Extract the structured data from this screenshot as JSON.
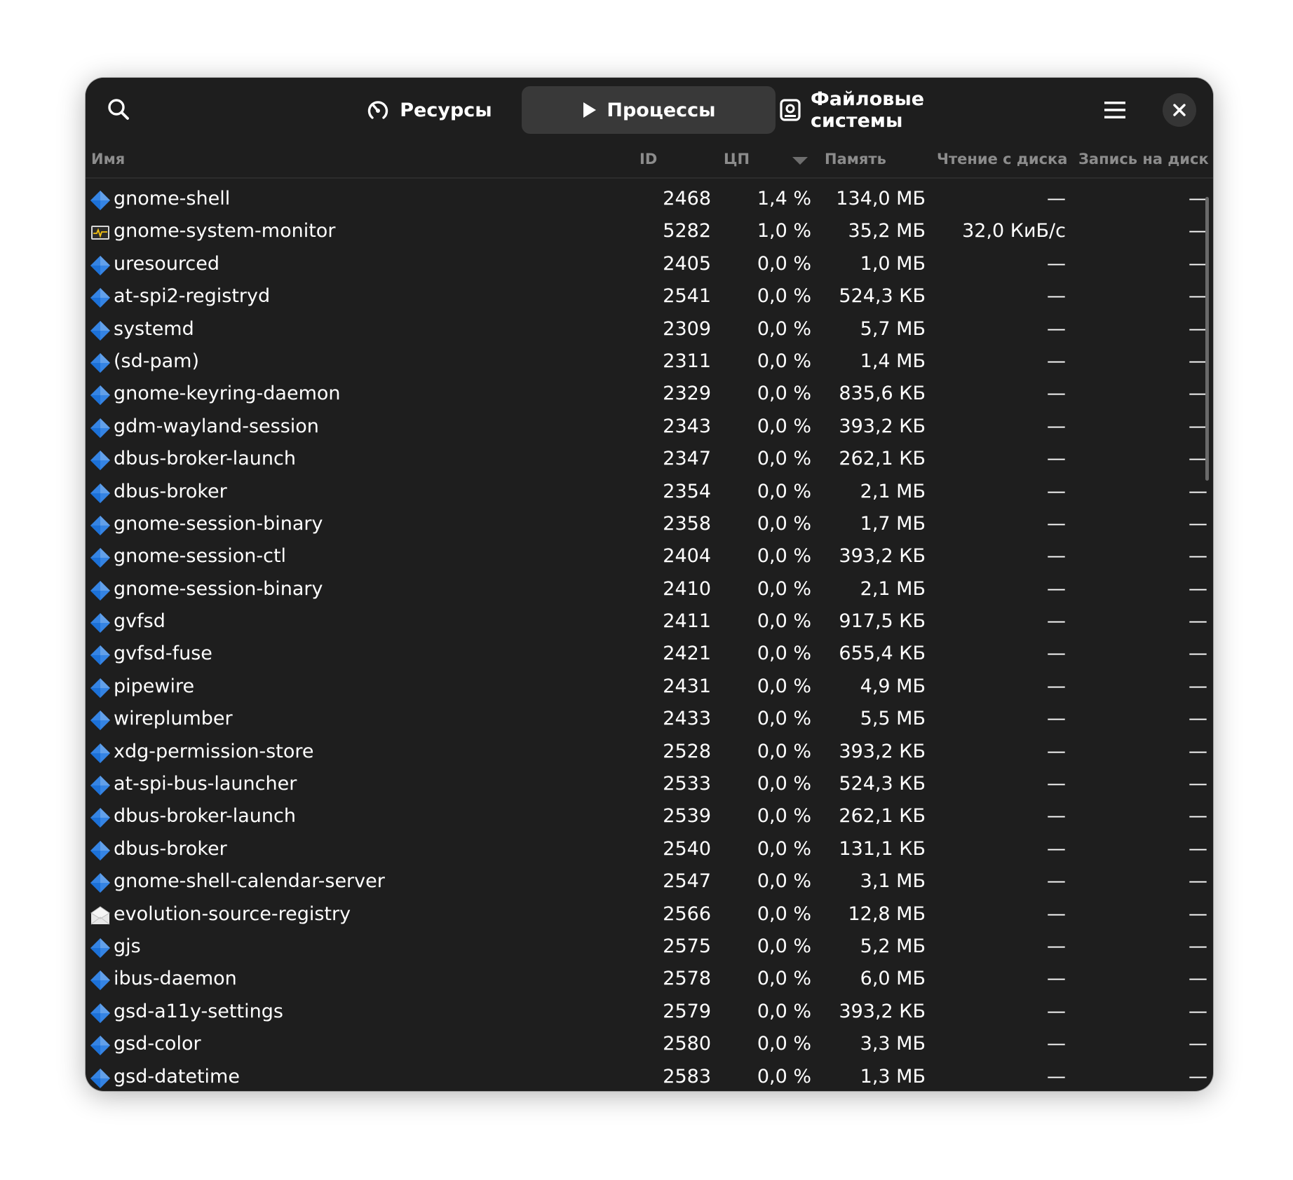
{
  "header": {
    "tabs": [
      {
        "label": "Ресурсы",
        "icon": "gauge-icon",
        "active": false
      },
      {
        "label": "Процессы",
        "icon": "play-icon",
        "active": true
      },
      {
        "label": "Файловые системы",
        "icon": "disk-icon",
        "active": false
      }
    ],
    "icons": {
      "search": "search-icon",
      "menu": "hamburger-menu-icon",
      "close": "close-icon"
    }
  },
  "columns": {
    "name": "Имя",
    "id": "ID",
    "cpu": "ЦП",
    "memory": "Память",
    "disk_read": "Чтение с диска",
    "disk_write": "Запись на диск",
    "sorted_by": "cpu",
    "sort_direction": "descending"
  },
  "processes": [
    {
      "name": "gnome-shell",
      "id": "2468",
      "cpu": "1,4 %",
      "memory": "134,0 МБ",
      "read": "—",
      "write": "—",
      "icon": "app-generic-icon"
    },
    {
      "name": "gnome-system-monitor",
      "id": "5282",
      "cpu": "1,0 %",
      "memory": "35,2 МБ",
      "read": "32,0 КиБ/с",
      "write": "—",
      "icon": "system-monitor-icon"
    },
    {
      "name": "uresourced",
      "id": "2405",
      "cpu": "0,0 %",
      "memory": "1,0 МБ",
      "read": "—",
      "write": "—",
      "icon": "app-generic-icon"
    },
    {
      "name": "at-spi2-registryd",
      "id": "2541",
      "cpu": "0,0 %",
      "memory": "524,3 КБ",
      "read": "—",
      "write": "—",
      "icon": "app-generic-icon"
    },
    {
      "name": "systemd",
      "id": "2309",
      "cpu": "0,0 %",
      "memory": "5,7 МБ",
      "read": "—",
      "write": "—",
      "icon": "app-generic-icon"
    },
    {
      "name": "(sd-pam)",
      "id": "2311",
      "cpu": "0,0 %",
      "memory": "1,4 МБ",
      "read": "—",
      "write": "—",
      "icon": "app-generic-icon"
    },
    {
      "name": "gnome-keyring-daemon",
      "id": "2329",
      "cpu": "0,0 %",
      "memory": "835,6 КБ",
      "read": "—",
      "write": "—",
      "icon": "app-generic-icon"
    },
    {
      "name": "gdm-wayland-session",
      "id": "2343",
      "cpu": "0,0 %",
      "memory": "393,2 КБ",
      "read": "—",
      "write": "—",
      "icon": "app-generic-icon"
    },
    {
      "name": "dbus-broker-launch",
      "id": "2347",
      "cpu": "0,0 %",
      "memory": "262,1 КБ",
      "read": "—",
      "write": "—",
      "icon": "app-generic-icon"
    },
    {
      "name": "dbus-broker",
      "id": "2354",
      "cpu": "0,0 %",
      "memory": "2,1 МБ",
      "read": "—",
      "write": "—",
      "icon": "app-generic-icon"
    },
    {
      "name": "gnome-session-binary",
      "id": "2358",
      "cpu": "0,0 %",
      "memory": "1,7 МБ",
      "read": "—",
      "write": "—",
      "icon": "app-generic-icon"
    },
    {
      "name": "gnome-session-ctl",
      "id": "2404",
      "cpu": "0,0 %",
      "memory": "393,2 КБ",
      "read": "—",
      "write": "—",
      "icon": "app-generic-icon"
    },
    {
      "name": "gnome-session-binary",
      "id": "2410",
      "cpu": "0,0 %",
      "memory": "2,1 МБ",
      "read": "—",
      "write": "—",
      "icon": "app-generic-icon"
    },
    {
      "name": "gvfsd",
      "id": "2411",
      "cpu": "0,0 %",
      "memory": "917,5 КБ",
      "read": "—",
      "write": "—",
      "icon": "app-generic-icon"
    },
    {
      "name": "gvfsd-fuse",
      "id": "2421",
      "cpu": "0,0 %",
      "memory": "655,4 КБ",
      "read": "—",
      "write": "—",
      "icon": "app-generic-icon"
    },
    {
      "name": "pipewire",
      "id": "2431",
      "cpu": "0,0 %",
      "memory": "4,9 МБ",
      "read": "—",
      "write": "—",
      "icon": "app-generic-icon"
    },
    {
      "name": "wireplumber",
      "id": "2433",
      "cpu": "0,0 %",
      "memory": "5,5 МБ",
      "read": "—",
      "write": "—",
      "icon": "app-generic-icon"
    },
    {
      "name": "xdg-permission-store",
      "id": "2528",
      "cpu": "0,0 %",
      "memory": "393,2 КБ",
      "read": "—",
      "write": "—",
      "icon": "app-generic-icon"
    },
    {
      "name": "at-spi-bus-launcher",
      "id": "2533",
      "cpu": "0,0 %",
      "memory": "524,3 КБ",
      "read": "—",
      "write": "—",
      "icon": "app-generic-icon"
    },
    {
      "name": "dbus-broker-launch",
      "id": "2539",
      "cpu": "0,0 %",
      "memory": "262,1 КБ",
      "read": "—",
      "write": "—",
      "icon": "app-generic-icon"
    },
    {
      "name": "dbus-broker",
      "id": "2540",
      "cpu": "0,0 %",
      "memory": "131,1 КБ",
      "read": "—",
      "write": "—",
      "icon": "app-generic-icon"
    },
    {
      "name": "gnome-shell-calendar-server",
      "id": "2547",
      "cpu": "0,0 %",
      "memory": "3,1 МБ",
      "read": "—",
      "write": "—",
      "icon": "app-generic-icon"
    },
    {
      "name": "evolution-source-registry",
      "id": "2566",
      "cpu": "0,0 %",
      "memory": "12,8 МБ",
      "read": "—",
      "write": "—",
      "icon": "mail-envelope-icon"
    },
    {
      "name": "gjs",
      "id": "2575",
      "cpu": "0,0 %",
      "memory": "5,2 МБ",
      "read": "—",
      "write": "—",
      "icon": "app-generic-icon"
    },
    {
      "name": "ibus-daemon",
      "id": "2578",
      "cpu": "0,0 %",
      "memory": "6,0 МБ",
      "read": "—",
      "write": "—",
      "icon": "app-generic-icon"
    },
    {
      "name": "gsd-a11y-settings",
      "id": "2579",
      "cpu": "0,0 %",
      "memory": "393,2 КБ",
      "read": "—",
      "write": "—",
      "icon": "app-generic-icon"
    },
    {
      "name": "gsd-color",
      "id": "2580",
      "cpu": "0,0 %",
      "memory": "3,3 МБ",
      "read": "—",
      "write": "—",
      "icon": "app-generic-icon"
    },
    {
      "name": "gsd-datetime",
      "id": "2583",
      "cpu": "0,0 %",
      "memory": "1,3 МБ",
      "read": "—",
      "write": "—",
      "icon": "app-generic-icon"
    }
  ],
  "colors": {
    "window_bg": "#1e1e1e",
    "active_tab_bg": "#393939",
    "header_text": "#8c8c8c",
    "text": "#ffffff",
    "app_icon_blue": "#3584e4"
  }
}
